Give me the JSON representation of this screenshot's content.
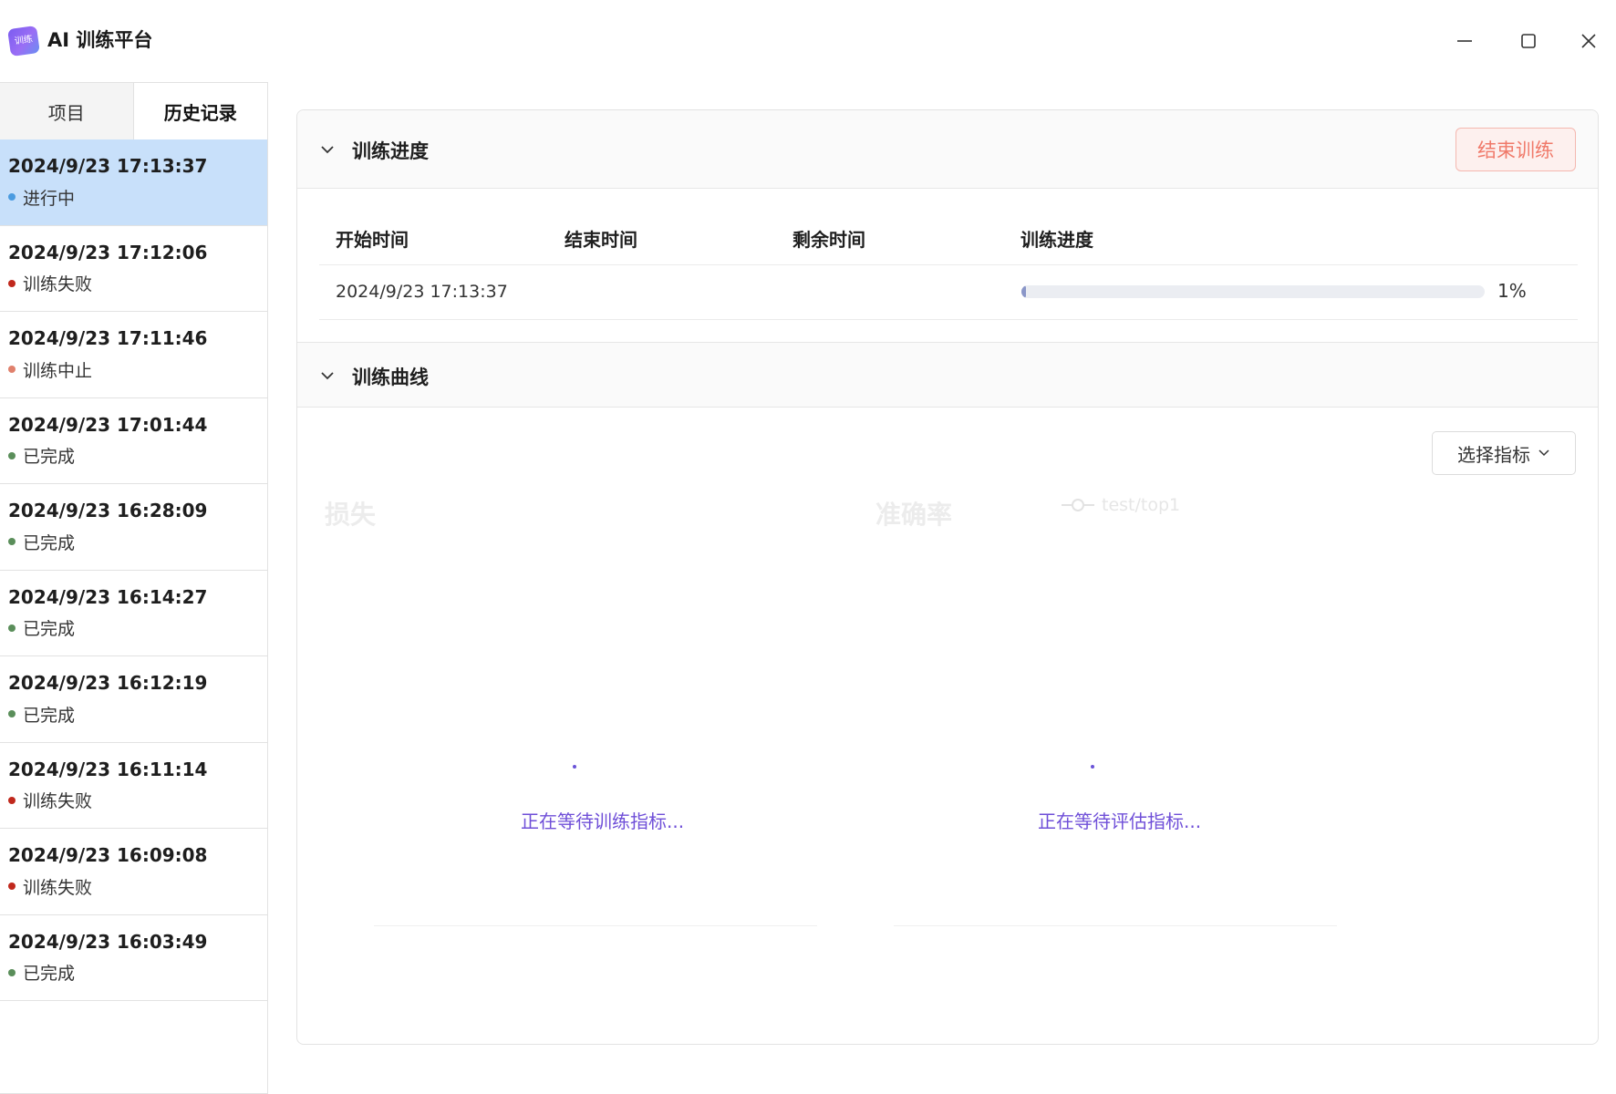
{
  "app": {
    "title": "AI 训练平台",
    "logo_text": "训练"
  },
  "sidebar": {
    "tabs": [
      {
        "label": "项目",
        "active": false
      },
      {
        "label": "历史记录",
        "active": true
      }
    ],
    "history": [
      {
        "date": "2024/9/23 17:13:37",
        "status": "进行中",
        "color": "#4a9be0",
        "selected": true
      },
      {
        "date": "2024/9/23 17:12:06",
        "status": "训练失败",
        "color": "#c0281c"
      },
      {
        "date": "2024/9/23 17:11:46",
        "status": "训练中止",
        "color": "#e0806c"
      },
      {
        "date": "2024/9/23 17:01:44",
        "status": "已完成",
        "color": "#5a8e5a"
      },
      {
        "date": "2024/9/23 16:28:09",
        "status": "已完成",
        "color": "#5a8e5a"
      },
      {
        "date": "2024/9/23 16:14:27",
        "status": "已完成",
        "color": "#5a8e5a"
      },
      {
        "date": "2024/9/23 16:12:19",
        "status": "已完成",
        "color": "#5a8e5a"
      },
      {
        "date": "2024/9/23 16:11:14",
        "status": "训练失败",
        "color": "#c0281c"
      },
      {
        "date": "2024/9/23 16:09:08",
        "status": "训练失败",
        "color": "#c0281c"
      },
      {
        "date": "2024/9/23 16:03:49",
        "status": "已完成",
        "color": "#5a8e5a"
      }
    ]
  },
  "progress_section": {
    "title": "训练进度",
    "end_button": "结束训练",
    "columns": [
      "开始时间",
      "结束时间",
      "剩余时间",
      "训练进度"
    ],
    "row": {
      "start": "2024/9/23 17:13:37",
      "end": "",
      "remaining": "",
      "progress_percent": 1,
      "progress_text": "1%"
    }
  },
  "curve_section": {
    "title": "训练曲线",
    "select_button": "选择指标",
    "loss_chart": {
      "title": "损失",
      "waiting": "正在等待训练指标..."
    },
    "accuracy_chart": {
      "title": "准确率",
      "legend": "test/top1",
      "waiting": "正在等待评估指标..."
    }
  }
}
